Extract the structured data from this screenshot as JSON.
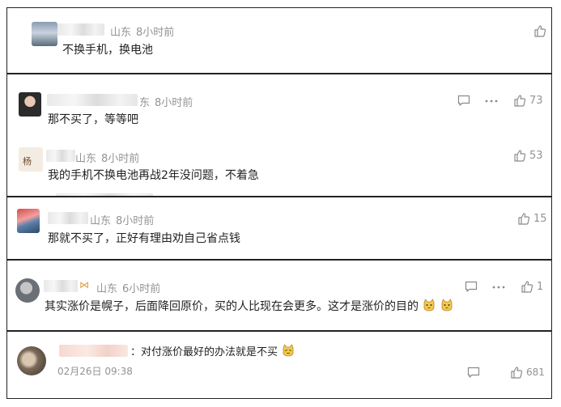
{
  "comments": [
    {
      "location": "山东",
      "time": "8小时前",
      "text": "不换手机，换电池",
      "like_icon": "thumb-up-icon"
    },
    {
      "location": "东",
      "time": "8小时前",
      "text": "那不买了，等等吧",
      "likes": "73",
      "reply_icon": "comment-icon",
      "more_icon": "more-dots-icon",
      "like_icon": "thumb-up-icon",
      "reply": {
        "location": "山东",
        "time": "8小时前",
        "text": "我的手机不换电池再战2年没问题，不着急",
        "likes": "53"
      }
    },
    {
      "location": "山东",
      "time": "8小时前",
      "text": "那就不买了，正好有理由劝自己省点钱",
      "likes": "15",
      "like_icon": "thumb-up-icon"
    },
    {
      "location": "山东",
      "time": "6小时前",
      "text": "其实涨价是幌子，后面降回原价，买的人比现在会更多。这才是涨价的目的",
      "likes": "1",
      "reply_icon": "comment-icon",
      "more_icon": "more-dots-icon",
      "like_icon": "thumb-up-icon",
      "emoji": "cat-face-icon"
    },
    {
      "text": "：对付涨价最好的办法就是不买",
      "date": "02月26日 09:38",
      "likes": "681",
      "emoji": "cat-face-icon",
      "reply_icon": "comment-icon",
      "like_icon": "thumb-up-icon"
    }
  ],
  "colors": {
    "text": "#222222",
    "meta": "#939393",
    "border": "#222222"
  }
}
